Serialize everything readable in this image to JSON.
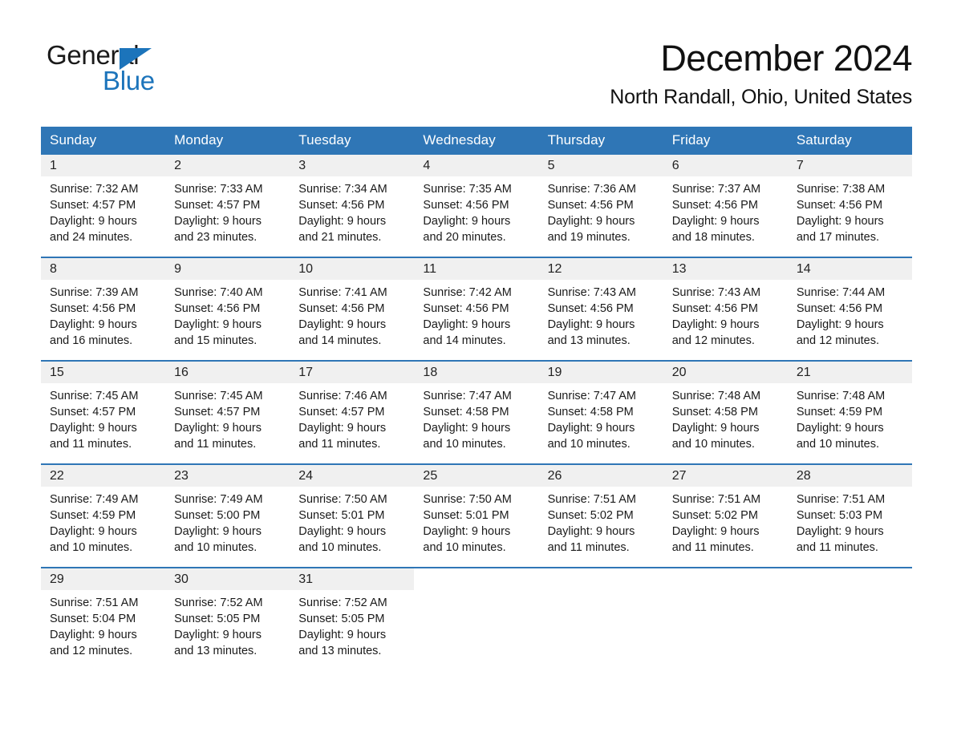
{
  "brand": {
    "name_part1": "General",
    "name_part2": "Blue",
    "accent_color": "#1c74bb",
    "header_color": "#2f76b6"
  },
  "header": {
    "month_title": "December 2024",
    "location": "North Randall, Ohio, United States"
  },
  "calendar": {
    "weekday_headers": [
      "Sunday",
      "Monday",
      "Tuesday",
      "Wednesday",
      "Thursday",
      "Friday",
      "Saturday"
    ],
    "weeks": [
      [
        {
          "day": "1",
          "sunrise": "Sunrise: 7:32 AM",
          "sunset": "Sunset: 4:57 PM",
          "daylight_line1": "Daylight: 9 hours",
          "daylight_line2": "and 24 minutes."
        },
        {
          "day": "2",
          "sunrise": "Sunrise: 7:33 AM",
          "sunset": "Sunset: 4:57 PM",
          "daylight_line1": "Daylight: 9 hours",
          "daylight_line2": "and 23 minutes."
        },
        {
          "day": "3",
          "sunrise": "Sunrise: 7:34 AM",
          "sunset": "Sunset: 4:56 PM",
          "daylight_line1": "Daylight: 9 hours",
          "daylight_line2": "and 21 minutes."
        },
        {
          "day": "4",
          "sunrise": "Sunrise: 7:35 AM",
          "sunset": "Sunset: 4:56 PM",
          "daylight_line1": "Daylight: 9 hours",
          "daylight_line2": "and 20 minutes."
        },
        {
          "day": "5",
          "sunrise": "Sunrise: 7:36 AM",
          "sunset": "Sunset: 4:56 PM",
          "daylight_line1": "Daylight: 9 hours",
          "daylight_line2": "and 19 minutes."
        },
        {
          "day": "6",
          "sunrise": "Sunrise: 7:37 AM",
          "sunset": "Sunset: 4:56 PM",
          "daylight_line1": "Daylight: 9 hours",
          "daylight_line2": "and 18 minutes."
        },
        {
          "day": "7",
          "sunrise": "Sunrise: 7:38 AM",
          "sunset": "Sunset: 4:56 PM",
          "daylight_line1": "Daylight: 9 hours",
          "daylight_line2": "and 17 minutes."
        }
      ],
      [
        {
          "day": "8",
          "sunrise": "Sunrise: 7:39 AM",
          "sunset": "Sunset: 4:56 PM",
          "daylight_line1": "Daylight: 9 hours",
          "daylight_line2": "and 16 minutes."
        },
        {
          "day": "9",
          "sunrise": "Sunrise: 7:40 AM",
          "sunset": "Sunset: 4:56 PM",
          "daylight_line1": "Daylight: 9 hours",
          "daylight_line2": "and 15 minutes."
        },
        {
          "day": "10",
          "sunrise": "Sunrise: 7:41 AM",
          "sunset": "Sunset: 4:56 PM",
          "daylight_line1": "Daylight: 9 hours",
          "daylight_line2": "and 14 minutes."
        },
        {
          "day": "11",
          "sunrise": "Sunrise: 7:42 AM",
          "sunset": "Sunset: 4:56 PM",
          "daylight_line1": "Daylight: 9 hours",
          "daylight_line2": "and 14 minutes."
        },
        {
          "day": "12",
          "sunrise": "Sunrise: 7:43 AM",
          "sunset": "Sunset: 4:56 PM",
          "daylight_line1": "Daylight: 9 hours",
          "daylight_line2": "and 13 minutes."
        },
        {
          "day": "13",
          "sunrise": "Sunrise: 7:43 AM",
          "sunset": "Sunset: 4:56 PM",
          "daylight_line1": "Daylight: 9 hours",
          "daylight_line2": "and 12 minutes."
        },
        {
          "day": "14",
          "sunrise": "Sunrise: 7:44 AM",
          "sunset": "Sunset: 4:56 PM",
          "daylight_line1": "Daylight: 9 hours",
          "daylight_line2": "and 12 minutes."
        }
      ],
      [
        {
          "day": "15",
          "sunrise": "Sunrise: 7:45 AM",
          "sunset": "Sunset: 4:57 PM",
          "daylight_line1": "Daylight: 9 hours",
          "daylight_line2": "and 11 minutes."
        },
        {
          "day": "16",
          "sunrise": "Sunrise: 7:45 AM",
          "sunset": "Sunset: 4:57 PM",
          "daylight_line1": "Daylight: 9 hours",
          "daylight_line2": "and 11 minutes."
        },
        {
          "day": "17",
          "sunrise": "Sunrise: 7:46 AM",
          "sunset": "Sunset: 4:57 PM",
          "daylight_line1": "Daylight: 9 hours",
          "daylight_line2": "and 11 minutes."
        },
        {
          "day": "18",
          "sunrise": "Sunrise: 7:47 AM",
          "sunset": "Sunset: 4:58 PM",
          "daylight_line1": "Daylight: 9 hours",
          "daylight_line2": "and 10 minutes."
        },
        {
          "day": "19",
          "sunrise": "Sunrise: 7:47 AM",
          "sunset": "Sunset: 4:58 PM",
          "daylight_line1": "Daylight: 9 hours",
          "daylight_line2": "and 10 minutes."
        },
        {
          "day": "20",
          "sunrise": "Sunrise: 7:48 AM",
          "sunset": "Sunset: 4:58 PM",
          "daylight_line1": "Daylight: 9 hours",
          "daylight_line2": "and 10 minutes."
        },
        {
          "day": "21",
          "sunrise": "Sunrise: 7:48 AM",
          "sunset": "Sunset: 4:59 PM",
          "daylight_line1": "Daylight: 9 hours",
          "daylight_line2": "and 10 minutes."
        }
      ],
      [
        {
          "day": "22",
          "sunrise": "Sunrise: 7:49 AM",
          "sunset": "Sunset: 4:59 PM",
          "daylight_line1": "Daylight: 9 hours",
          "daylight_line2": "and 10 minutes."
        },
        {
          "day": "23",
          "sunrise": "Sunrise: 7:49 AM",
          "sunset": "Sunset: 5:00 PM",
          "daylight_line1": "Daylight: 9 hours",
          "daylight_line2": "and 10 minutes."
        },
        {
          "day": "24",
          "sunrise": "Sunrise: 7:50 AM",
          "sunset": "Sunset: 5:01 PM",
          "daylight_line1": "Daylight: 9 hours",
          "daylight_line2": "and 10 minutes."
        },
        {
          "day": "25",
          "sunrise": "Sunrise: 7:50 AM",
          "sunset": "Sunset: 5:01 PM",
          "daylight_line1": "Daylight: 9 hours",
          "daylight_line2": "and 10 minutes."
        },
        {
          "day": "26",
          "sunrise": "Sunrise: 7:51 AM",
          "sunset": "Sunset: 5:02 PM",
          "daylight_line1": "Daylight: 9 hours",
          "daylight_line2": "and 11 minutes."
        },
        {
          "day": "27",
          "sunrise": "Sunrise: 7:51 AM",
          "sunset": "Sunset: 5:02 PM",
          "daylight_line1": "Daylight: 9 hours",
          "daylight_line2": "and 11 minutes."
        },
        {
          "day": "28",
          "sunrise": "Sunrise: 7:51 AM",
          "sunset": "Sunset: 5:03 PM",
          "daylight_line1": "Daylight: 9 hours",
          "daylight_line2": "and 11 minutes."
        }
      ],
      [
        {
          "day": "29",
          "sunrise": "Sunrise: 7:51 AM",
          "sunset": "Sunset: 5:04 PM",
          "daylight_line1": "Daylight: 9 hours",
          "daylight_line2": "and 12 minutes."
        },
        {
          "day": "30",
          "sunrise": "Sunrise: 7:52 AM",
          "sunset": "Sunset: 5:05 PM",
          "daylight_line1": "Daylight: 9 hours",
          "daylight_line2": "and 13 minutes."
        },
        {
          "day": "31",
          "sunrise": "Sunrise: 7:52 AM",
          "sunset": "Sunset: 5:05 PM",
          "daylight_line1": "Daylight: 9 hours",
          "daylight_line2": "and 13 minutes."
        },
        {
          "day": "",
          "sunrise": "",
          "sunset": "",
          "daylight_line1": "",
          "daylight_line2": ""
        },
        {
          "day": "",
          "sunrise": "",
          "sunset": "",
          "daylight_line1": "",
          "daylight_line2": ""
        },
        {
          "day": "",
          "sunrise": "",
          "sunset": "",
          "daylight_line1": "",
          "daylight_line2": ""
        },
        {
          "day": "",
          "sunrise": "",
          "sunset": "",
          "daylight_line1": "",
          "daylight_line2": ""
        }
      ]
    ]
  }
}
